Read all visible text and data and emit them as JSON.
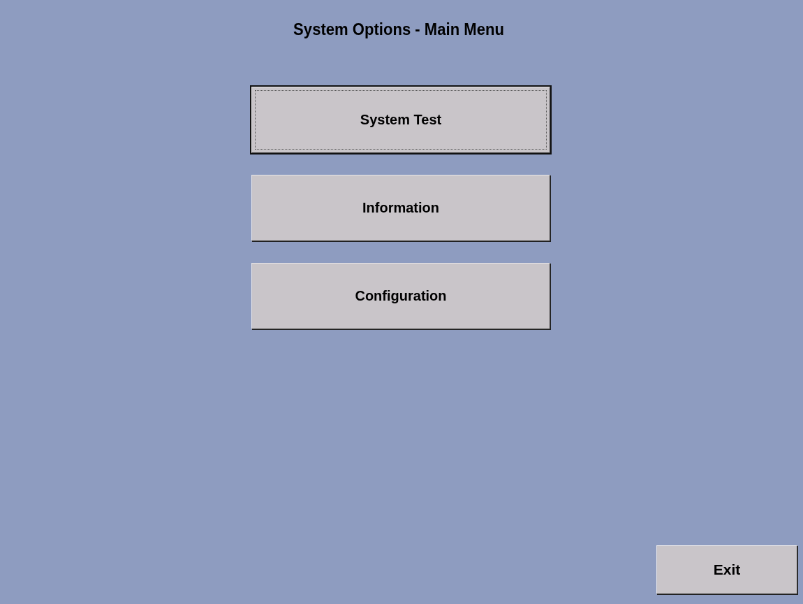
{
  "window": {
    "title": "System Options - Main Menu"
  },
  "menu": [
    {
      "label": "System Test",
      "focused": true
    },
    {
      "label": "Information",
      "focused": false
    },
    {
      "label": "Configuration",
      "focused": false
    }
  ],
  "exit_button": {
    "label": "Exit"
  }
}
